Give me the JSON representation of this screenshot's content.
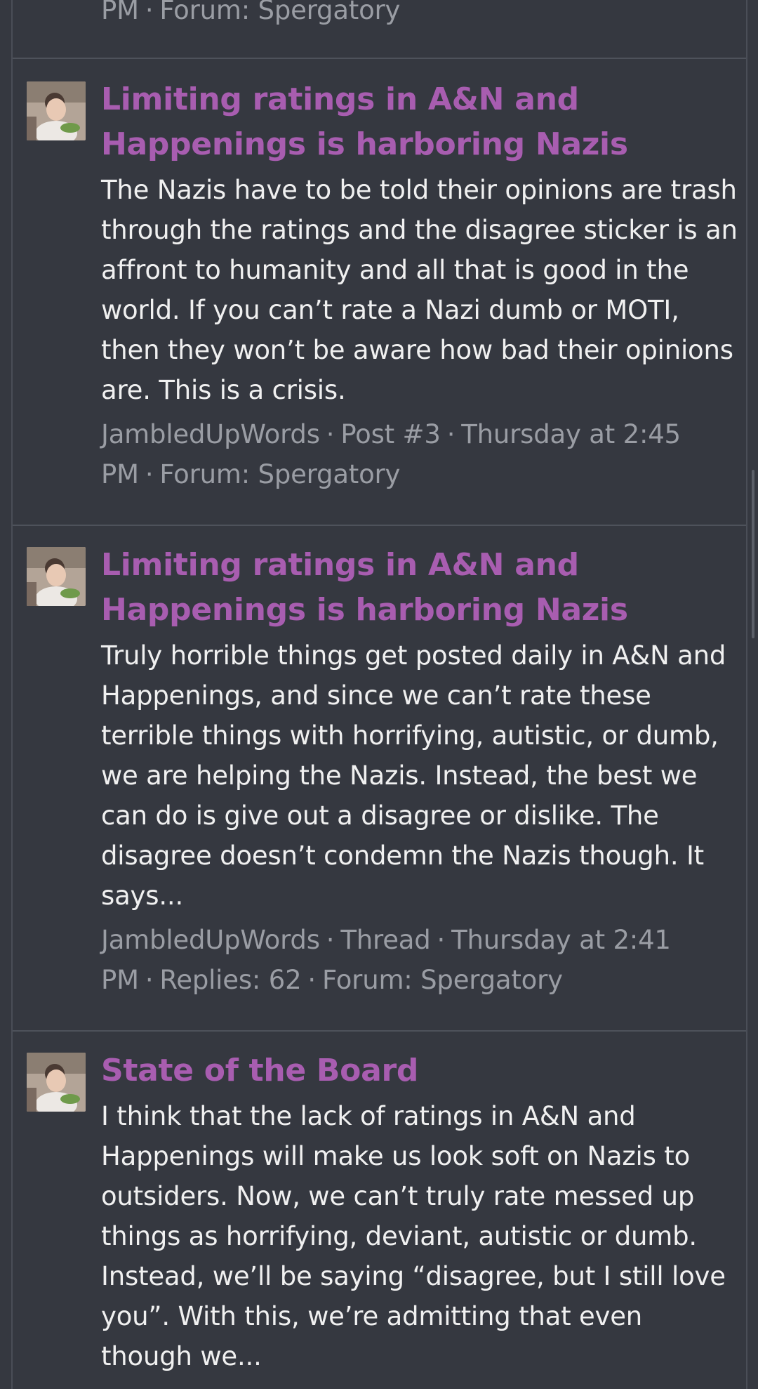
{
  "top_partial": {
    "meta_tail": "PM",
    "forum_label": "Forum: Spergatory"
  },
  "results": [
    {
      "title": "Limiting ratings in A&N and Happenings is harboring Nazis",
      "snippet": "The Nazis have to be told their opinions are trash through the ratings and the disagree sticker is an affront to humanity and all that is good in the world. If you can’t rate a Nazi dumb or MOTI, then they won’t be aware how bad their opinions are. This is a crisis.",
      "author": "JambledUpWords",
      "type": "Post #3",
      "time": "Thursday at 2:45 PM",
      "extra": "",
      "forum": "Forum: Spergatory"
    },
    {
      "title": "Limiting ratings in A&N and Happenings is harboring Nazis",
      "snippet": "Truly horrible things get posted daily in A&N and Happenings, and since we can’t rate these terrible things with horrifying, autistic, or dumb, we are helping the Nazis. Instead, the best we can do is give out a disagree or dislike. The disagree doesn’t condemn the Nazis though. It says...",
      "author": "JambledUpWords",
      "type": "Thread",
      "time": "Thursday at 2:41 PM",
      "extra": "Replies: 62",
      "forum": "Forum: Spergatory"
    },
    {
      "title": "State of the Board",
      "snippet": "I think that the lack of ratings in A&N and Happenings will make us look soft on Nazis to outsiders. Now, we can’t truly rate messed up things as horrifying, deviant, autistic or dumb. Instead, we’ll be saying “disagree, but I still love you”. With this, we’re admitting that even though we...",
      "author": "",
      "type": "",
      "time": "",
      "extra": "",
      "forum": ""
    }
  ],
  "colors": {
    "background": "#353840",
    "title": "#a85db0",
    "meta": "#9a9da4",
    "divider": "#4e525b"
  }
}
